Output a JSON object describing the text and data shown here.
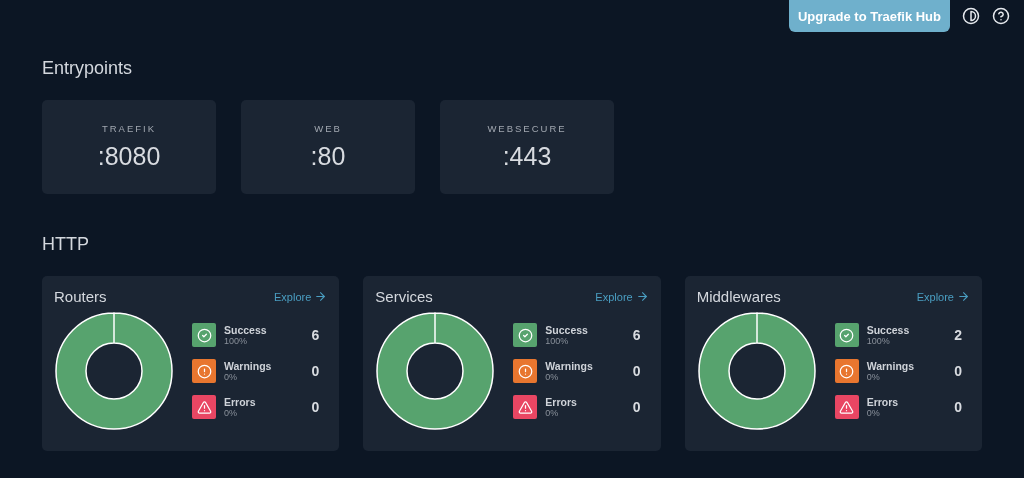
{
  "header": {
    "upgrade_button": "Upgrade to Traefik Hub"
  },
  "entrypoints": {
    "title": "Entrypoints",
    "items": [
      {
        "name": "TRAEFIK",
        "port": ":8080"
      },
      {
        "name": "WEB",
        "port": ":80"
      },
      {
        "name": "WEBSECURE",
        "port": ":443"
      }
    ]
  },
  "http": {
    "title": "HTTP",
    "cards": [
      {
        "title": "Routers",
        "link": "Explore",
        "stats": [
          {
            "kind": "success",
            "label": "Success",
            "percent": "100%",
            "count": "6"
          },
          {
            "kind": "warning",
            "label": "Warnings",
            "percent": "0%",
            "count": "0"
          },
          {
            "kind": "error",
            "label": "Errors",
            "percent": "0%",
            "count": "0"
          }
        ]
      },
      {
        "title": "Services",
        "link": "Explore",
        "stats": [
          {
            "kind": "success",
            "label": "Success",
            "percent": "100%",
            "count": "6"
          },
          {
            "kind": "warning",
            "label": "Warnings",
            "percent": "0%",
            "count": "0"
          },
          {
            "kind": "error",
            "label": "Errors",
            "percent": "0%",
            "count": "0"
          }
        ]
      },
      {
        "title": "Middlewares",
        "link": "Explore",
        "stats": [
          {
            "kind": "success",
            "label": "Success",
            "percent": "100%",
            "count": "2"
          },
          {
            "kind": "warning",
            "label": "Warnings",
            "percent": "0%",
            "count": "0"
          },
          {
            "kind": "error",
            "label": "Errors",
            "percent": "0%",
            "count": "0"
          }
        ]
      }
    ]
  }
}
